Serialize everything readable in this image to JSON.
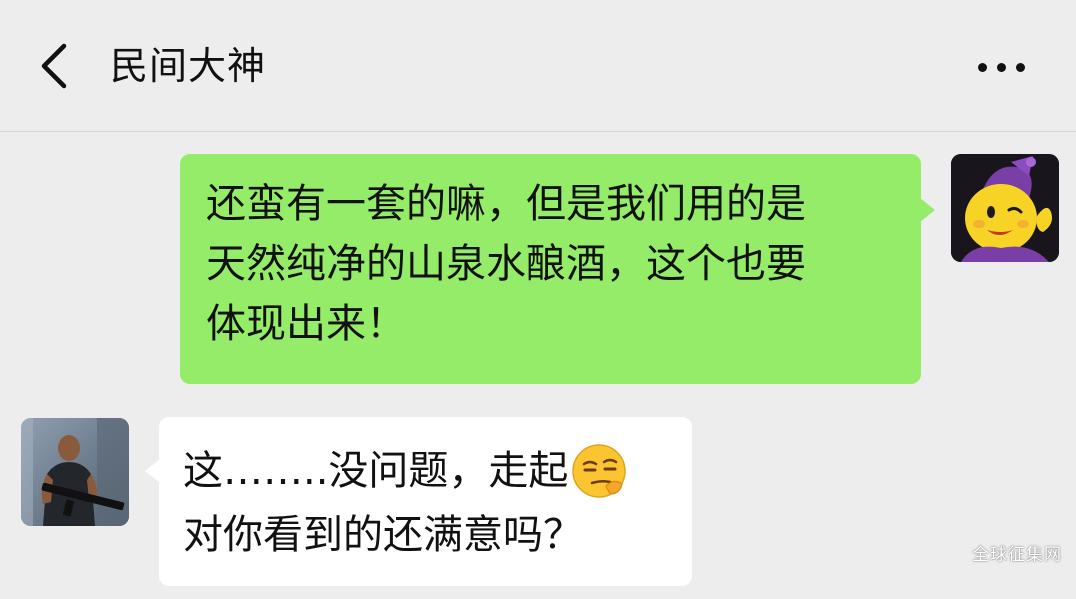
{
  "header": {
    "title": "民间大神"
  },
  "icons": {
    "back": "chevron-left-icon",
    "more": "more-horizontal-icon",
    "emoji": "smirk-emoji-icon"
  },
  "messages": [
    {
      "direction": "outgoing",
      "lines": [
        "还蛮有一套的嘛，但是我们用的是",
        "天然纯净的山泉水酿酒，这个也要",
        "体现出来！"
      ]
    },
    {
      "direction": "incoming",
      "lines": [
        "这……..没问题，走起",
        "对你看到的还满意吗？"
      ]
    }
  ],
  "watermark": "全球征集网",
  "colors": {
    "background": "#ededed",
    "outgoing_bubble": "#95ec69",
    "incoming_bubble": "#ffffff",
    "text": "#111111"
  }
}
